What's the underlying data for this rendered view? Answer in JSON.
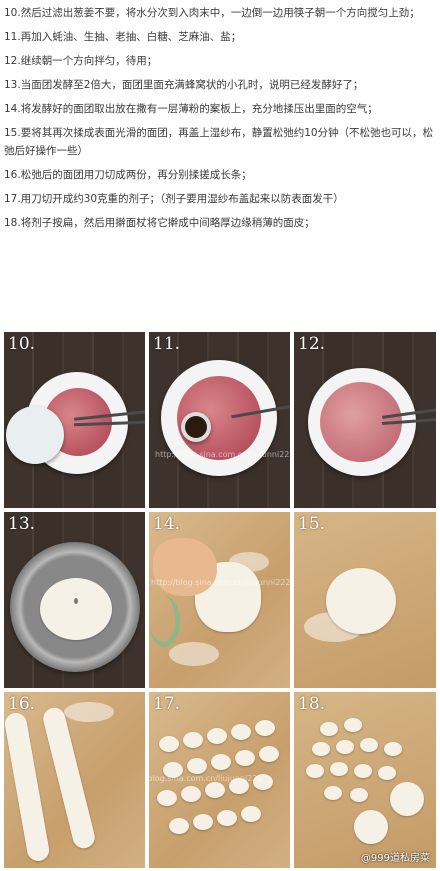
{
  "steps": [
    "10.然后过滤出葱姜不要，将水分次到入肉末中，一边倒一边用筷子朝一个方向搅匀上劲；",
    "11.再加入蚝油、生抽、老抽、白糖、芝麻油、盐；",
    "12.继续朝一个方向拌匀，待用；",
    "13.当面团发酵至2倍大，面团里面充满蜂窝状的小孔时，说明已经发酵好了；",
    "14.将发酵好的面团取出放在撒有一层薄粉的案板上，充分地揉压出里面的空气；",
    "15.要将其再次揉成表面光滑的面团，再盖上湿纱布，静置松弛约10分钟（不松弛也可以，松弛后好操作一些）",
    "16.松弛后的面团用刀切成两份，再分别揉搓成长条；",
    "17.用刀切开成约30克重的剂子；（剂子要用湿纱布盖起来以防表面发干）",
    "18.将剂子按扁，然后用擀面杖将它擀成中间略厚边缘稍薄的面皮；"
  ],
  "photos": {
    "labels": [
      "10.",
      "11.",
      "12.",
      "13.",
      "14.",
      "15.",
      "16.",
      "17.",
      "18."
    ],
    "watermark": "http://blog.sina.com.cn/liujunni222",
    "credit": "@999道私房菜"
  },
  "colors": {
    "text": "#3a3a3a",
    "wood_dark": "#3d332c",
    "board": "#d2b083",
    "meat": "#b85460",
    "dough": "#f6f1e6"
  }
}
